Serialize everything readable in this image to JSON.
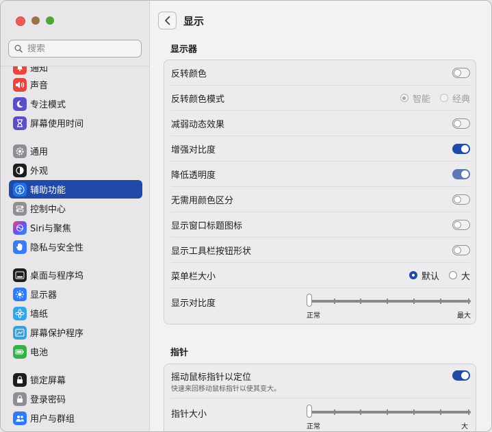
{
  "sidebar": {
    "search_placeholder": "搜索",
    "items": [
      {
        "label": "通知",
        "color": "#e8453c"
      },
      {
        "label": "声音",
        "color": "#e8453c"
      },
      {
        "label": "专注模式",
        "color": "#5b4fc9"
      },
      {
        "label": "屏幕使用时间",
        "color": "#5b4fc9"
      },
      {
        "label": "通用",
        "color": "#8e8e93"
      },
      {
        "label": "外观",
        "color": "#1d1d1f"
      },
      {
        "label": "辅助功能",
        "color": "#1f6fe5"
      },
      {
        "label": "控制中心",
        "color": "#8e8e93"
      },
      {
        "label": "Siri与聚焦",
        "color": "#a03dd0"
      },
      {
        "label": "隐私与安全性",
        "color": "#3a7bf0"
      },
      {
        "label": "桌面与程序坞",
        "color": "#1d1d1f"
      },
      {
        "label": "显示器",
        "color": "#2b7cf5"
      },
      {
        "label": "墙纸",
        "color": "#34a7e8"
      },
      {
        "label": "屏幕保护程序",
        "color": "#3aa0d6"
      },
      {
        "label": "电池",
        "color": "#34b24a"
      },
      {
        "label": "锁定屏幕",
        "color": "#1d1d1f"
      },
      {
        "label": "登录密码",
        "color": "#8e8e93"
      },
      {
        "label": "用户与群组",
        "color": "#2b7cf5"
      }
    ]
  },
  "main": {
    "title": "显示",
    "display_section": {
      "title": "显示器",
      "rows": [
        {
          "label": "反转颜色",
          "state": "off"
        },
        {
          "label": "反转颜色模式",
          "options": [
            "智能",
            "经典"
          ],
          "selected": "智能",
          "disabled": true
        },
        {
          "label": "减弱动态效果",
          "state": "off"
        },
        {
          "label": "增强对比度",
          "state": "on"
        },
        {
          "label": "降低透明度",
          "state": "on"
        },
        {
          "label": "无需用颜色区分",
          "state": "off"
        },
        {
          "label": "显示窗口标题图标",
          "state": "off"
        },
        {
          "label": "显示工具栏按钮形状",
          "state": "off"
        },
        {
          "label": "菜单栏大小",
          "options": [
            "默认",
            "大"
          ],
          "selected": "默认"
        },
        {
          "label": "显示对比度",
          "slider": {
            "value": 0,
            "min_label": "正常",
            "max_label": "最大"
          }
        }
      ]
    },
    "pointer_section": {
      "title": "指针",
      "shake_label": "摇动鼠标指针以定位",
      "shake_desc": "快速来回移动鼠标指针以使其变大。",
      "shake_state": "on",
      "size_label": "指针大小",
      "size_slider": {
        "value": 0,
        "min_label": "正常",
        "max_label": "大"
      }
    }
  },
  "accent_color": "#1f4aa8"
}
